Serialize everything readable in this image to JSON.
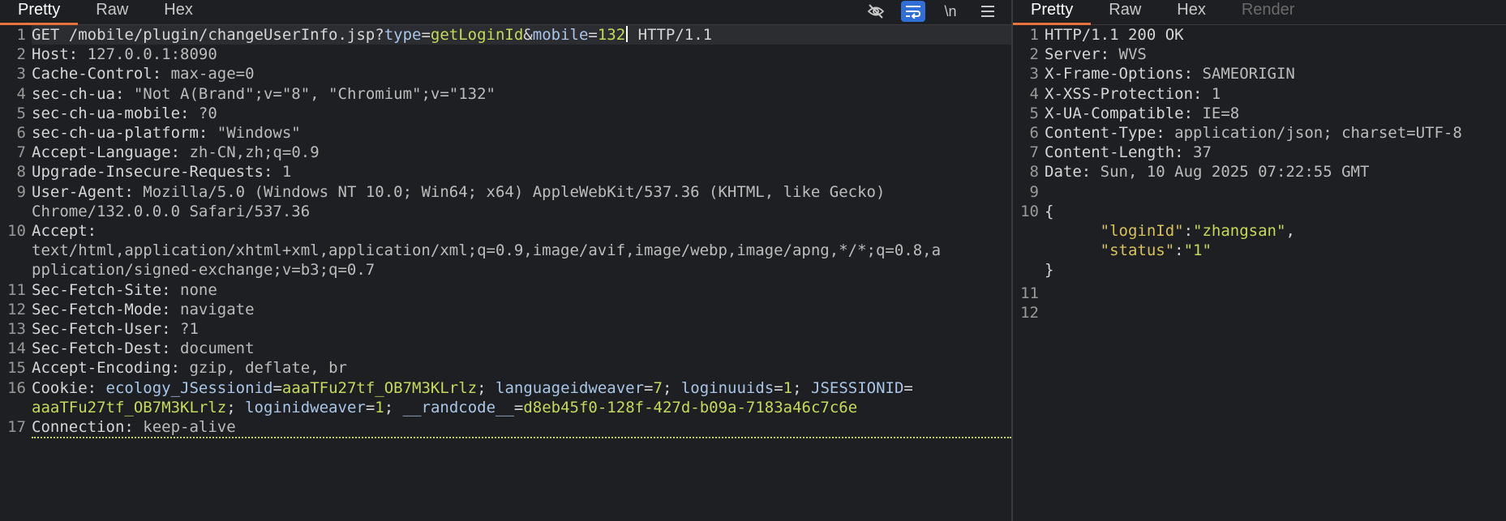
{
  "request_tabs": [
    "Pretty",
    "Raw",
    "Hex"
  ],
  "response_tabs": [
    "Pretty",
    "Raw",
    "Hex",
    "Render"
  ],
  "toolbar": {
    "hide_icon": "eye-slash-icon",
    "wrap_icon": "wrap-lines-icon",
    "newline_label": "\\n",
    "menu_icon": "hamburger-menu-icon"
  },
  "request": {
    "line1": {
      "method_path": "GET /mobile/plugin/changeUserInfo.jsp?",
      "p1_key": "type",
      "p1_eq": "=",
      "p1_val": "getLoginId",
      "amp": "&",
      "p2_key": "mobile",
      "p2_eq": "=",
      "p2_val": "132",
      "proto": " HTTP/1.1"
    },
    "headers": [
      {
        "n": "2",
        "k": "Host",
        "v": "127.0.0.1:8090"
      },
      {
        "n": "3",
        "k": "Cache-Control",
        "v": "max-age=0"
      },
      {
        "n": "4",
        "k": "sec-ch-ua",
        "v": "\"Not A(Brand\";v=\"8\", \"Chromium\";v=\"132\""
      },
      {
        "n": "5",
        "k": "sec-ch-ua-mobile",
        "v": "?0"
      },
      {
        "n": "6",
        "k": "sec-ch-ua-platform",
        "v": "\"Windows\""
      },
      {
        "n": "7",
        "k": "Accept-Language",
        "v": "zh-CN,zh;q=0.9"
      },
      {
        "n": "8",
        "k": "Upgrade-Insecure-Requests",
        "v": "1"
      },
      {
        "n": "9",
        "k": "User-Agent",
        "v": "Mozilla/5.0 (Windows NT 10.0; Win64; x64) AppleWebKit/537.36 (KHTML, like Gecko)",
        "v2": "Chrome/132.0.0.0 Safari/537.36"
      },
      {
        "n": "10",
        "k": "Accept",
        "v": "",
        "v2": "text/html,application/xhtml+xml,application/xml;q=0.9,image/avif,image/webp,image/apng,*/*;q=0.8,a",
        "v3": "pplication/signed-exchange;v=b3;q=0.7"
      },
      {
        "n": "11",
        "k": "Sec-Fetch-Site",
        "v": "none"
      },
      {
        "n": "12",
        "k": "Sec-Fetch-Mode",
        "v": "navigate"
      },
      {
        "n": "13",
        "k": "Sec-Fetch-User",
        "v": "?1"
      },
      {
        "n": "14",
        "k": "Sec-Fetch-Dest",
        "v": "document"
      },
      {
        "n": "15",
        "k": "Accept-Encoding",
        "v": "gzip, deflate, br"
      }
    ],
    "cookie": {
      "n": "16",
      "k": "Cookie",
      "c1k": "ecology_JSessionid",
      "c1v": "aaaTFu27tf_OB7M3KLrlz",
      "c2k": "languageidweaver",
      "c2v": "7",
      "c3k": "loginuuids",
      "c3v": "1",
      "c4k": "JSESSIONID",
      "c4v": "aaaTFu27tf_OB7M3KLrlz",
      "c5k": "loginidweaver",
      "c5v": "1",
      "c6k": "__randcode__",
      "c6v": "d8eb45f0-128f-427d-b09a-7183a46c7c6e"
    },
    "connection": {
      "n": "17",
      "k": "Connection",
      "v": "keep-alive"
    }
  },
  "response": {
    "status": "HTTP/1.1 200 OK",
    "headers": [
      {
        "n": "2",
        "k": "Server",
        "v": "WVS"
      },
      {
        "n": "3",
        "k": "X-Frame-Options",
        "v": "SAMEORIGIN"
      },
      {
        "n": "4",
        "k": "X-XSS-Protection",
        "v": "1"
      },
      {
        "n": "5",
        "k": "X-UA-Compatible",
        "v": "IE=8"
      },
      {
        "n": "6",
        "k": "Content-Type",
        "v": "application/json; charset=UTF-8"
      },
      {
        "n": "7",
        "k": "Content-Length",
        "v": "37"
      },
      {
        "n": "8",
        "k": "Date",
        "v": "Sun, 10 Aug 2025 07:22:55 GMT"
      }
    ],
    "json": {
      "open": "{",
      "k1": "\"loginId\"",
      "v1": "\"zhangsan\"",
      "k2": "\"status\"",
      "v2": "\"1\"",
      "close": "}"
    },
    "line_numbers": [
      "1",
      "2",
      "3",
      "4",
      "5",
      "6",
      "7",
      "8",
      "9",
      "10",
      "11",
      "12"
    ]
  },
  "colors": {
    "accent": "#e8743b",
    "wrap_active": "#2f6fd6",
    "param_value": "#c6d95a",
    "json_key": "#d8c25c"
  }
}
